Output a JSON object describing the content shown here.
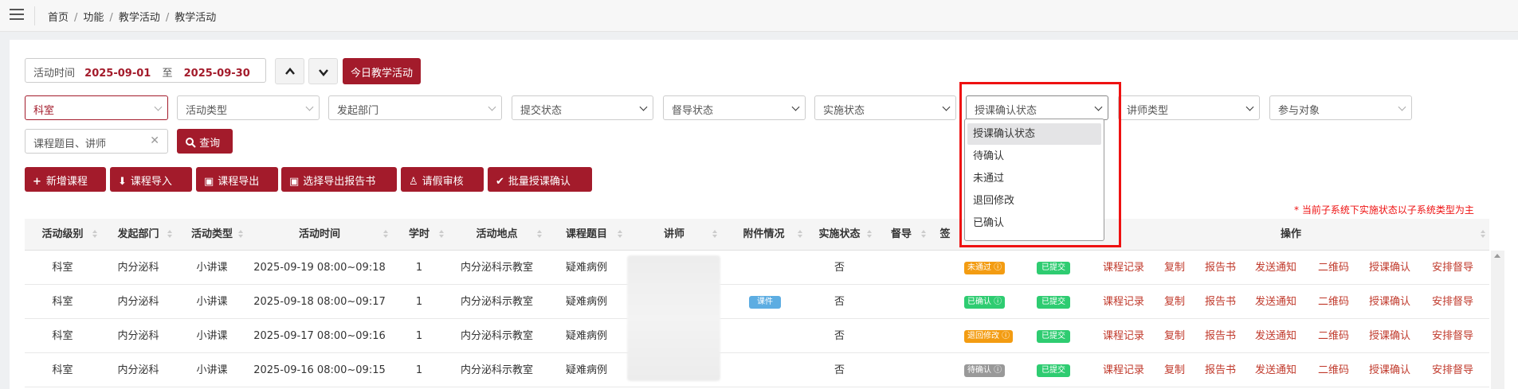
{
  "breadcrumb": [
    "首页",
    "功能",
    "教学活动",
    "教学活动"
  ],
  "filters": {
    "date_label": "活动时间",
    "date_from": "2025-09-01",
    "date_to_sep": "至",
    "date_to": "2025-09-30",
    "today_btn": "今日教学活动",
    "dept": "科室",
    "activity_type": "活动类型",
    "origin_dept": "发起部门",
    "submit_status": "提交状态",
    "supervise_status": "督导状态",
    "impl_status": "实施状态",
    "confirm_status": "授课确认状态",
    "lecturer_type": "讲师类型",
    "participants": "参与对象",
    "keyword_placeholder": "课程题目、讲师",
    "query_btn": "查询"
  },
  "toolbar": {
    "add": "新增课程",
    "import": "课程导入",
    "export": "课程导出",
    "export_report": "选择导出报告书",
    "leave": "请假审核",
    "batch_confirm": "批量授课确认"
  },
  "notice": "* 当前子系统下实施状态以子系统类型为主",
  "dropdown": {
    "options": [
      "授课确认状态",
      "待确认",
      "未通过",
      "退回修改",
      "已确认"
    ],
    "selected": 0
  },
  "table": {
    "headers": [
      "活动级别",
      "发起部门",
      "活动类型",
      "活动时间",
      "学时",
      "活动地点",
      "课程题目",
      "讲师",
      "附件情况",
      "实施状态",
      "督导",
      "签",
      "操作"
    ],
    "ops": [
      "课程记录",
      "复制",
      "报告书",
      "发送通知",
      "二维码",
      "授课确认",
      "安排督导"
    ],
    "rows": [
      {
        "level": "科室",
        "dept": "内分泌科",
        "type": "小讲课",
        "time": "2025-09-19  08:00~09:18",
        "hours": "1",
        "place": "内分泌科示教室",
        "title": "疑难病例",
        "attach": "",
        "impl": "否",
        "confirm": "未通过",
        "confirm_color": "#f39c12",
        "submit": "已提交"
      },
      {
        "level": "科室",
        "dept": "内分泌科",
        "type": "小讲课",
        "time": "2025-09-18  08:00~09:17",
        "hours": "1",
        "place": "内分泌科示教室",
        "title": "疑难病例",
        "attach": "课件",
        "impl": "否",
        "confirm": "已确认",
        "confirm_color": "#2ecc71",
        "submit": "已提交"
      },
      {
        "level": "科室",
        "dept": "内分泌科",
        "type": "小讲课",
        "time": "2025-09-17  08:00~09:16",
        "hours": "1",
        "place": "内分泌科示教室",
        "title": "疑难病例",
        "attach": "",
        "impl": "否",
        "confirm": "退回修改",
        "confirm_color": "#f39c12",
        "submit": "已提交"
      },
      {
        "level": "科室",
        "dept": "内分泌科",
        "type": "小讲课",
        "time": "2025-09-16  08:00~09:15",
        "hours": "1",
        "place": "内分泌科示教室",
        "title": "疑难病例",
        "attach": "",
        "impl": "否",
        "confirm": "待确认",
        "confirm_color": "#999999",
        "submit": "已提交"
      }
    ]
  }
}
